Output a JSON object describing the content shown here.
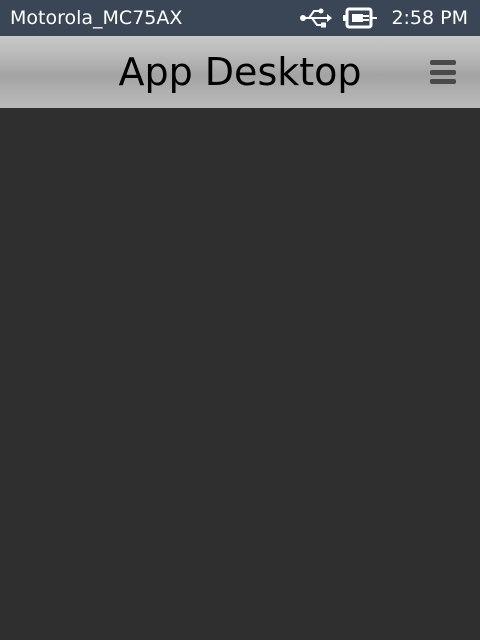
{
  "status_bar": {
    "device_name": "Motorola_MC75AX",
    "time": "2:58 PM",
    "icons": [
      "usb-icon",
      "battery-charging-icon"
    ]
  },
  "header": {
    "title": "App Desktop",
    "menu_icon": "hamburger-menu-icon"
  },
  "colors": {
    "status_bar_bg": "#3a4656",
    "title_bar_bg": "#b0b0b0",
    "desktop_bg": "#2f2f2f"
  }
}
